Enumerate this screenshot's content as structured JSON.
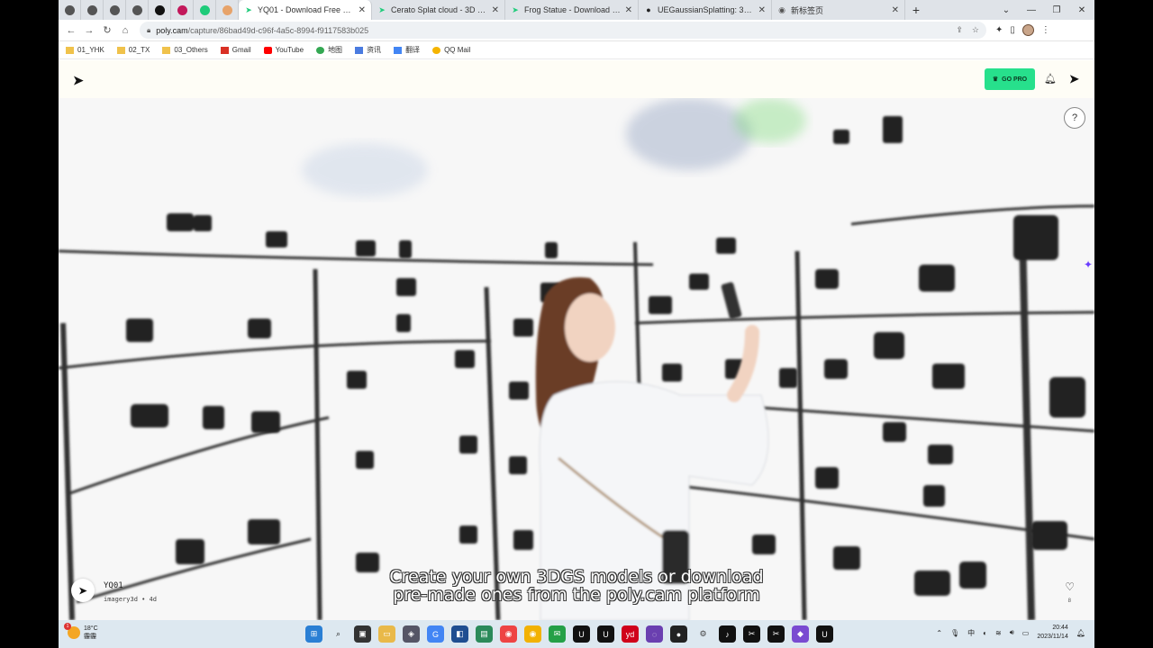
{
  "browser": {
    "tabs": [
      {
        "title": "YQ01 - Download Free 3D Mo",
        "active": true
      },
      {
        "title": "Cerato Splat cloud - 3D Mode",
        "active": false
      },
      {
        "title": "Frog Statue - Download Free",
        "active": false
      },
      {
        "title": "UEGaussianSplatting: 3D Gau",
        "active": false
      },
      {
        "title": "新标签页",
        "active": false
      }
    ],
    "url_host": "poly.cam",
    "url_path": "/capture/86bad49d-c96f-4a5c-8994-f9117583b025",
    "bookmarks": [
      "01_YHK",
      "02_TX",
      "03_Others",
      "Gmail",
      "YouTube",
      "地图",
      "资讯",
      "翻译",
      "QQ Mail"
    ]
  },
  "page": {
    "go_pro_label": "GO PRO",
    "help_label": "?",
    "model_name": "YQ01",
    "model_meta": "imagery3d • 4d",
    "like_count": "8",
    "caption_line1": "Create your own 3DGS models or download",
    "caption_line2": "pre-made ones from the poly.cam platform"
  },
  "taskbar": {
    "weather_temp": "18°C",
    "weather_desc": "霾霾",
    "ime": "中",
    "time": "20:44",
    "date": "2023/11/14"
  },
  "colors": {
    "go_pro": "#27e08c",
    "accent_tab": "#1ecb7a"
  }
}
